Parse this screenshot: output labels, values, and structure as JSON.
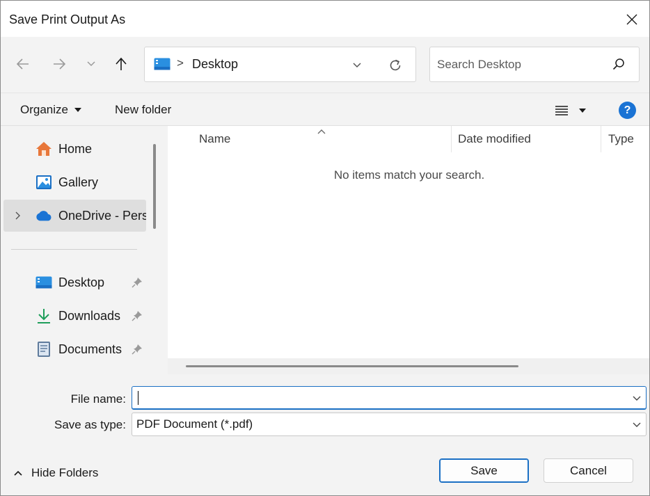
{
  "window": {
    "title": "Save Print Output As"
  },
  "address_bar": {
    "location_icon": "desktop-folder-icon",
    "separator": ">",
    "current_location": "Desktop"
  },
  "search": {
    "placeholder": "Search Desktop",
    "value": ""
  },
  "command_bar": {
    "organize_label": "Organize",
    "new_folder_label": "New folder"
  },
  "sidebar": {
    "items": [
      {
        "label": "Home",
        "icon": "home-icon",
        "selected": false
      },
      {
        "label": "Gallery",
        "icon": "gallery-icon",
        "selected": false
      },
      {
        "label": "OneDrive - Perso",
        "icon": "onedrive-cloud-icon",
        "selected": true,
        "expandable": true
      },
      {
        "label": "Desktop",
        "icon": "desktop-folder-icon",
        "pinned": true
      },
      {
        "label": "Downloads",
        "icon": "download-arrow-icon",
        "pinned": true
      },
      {
        "label": "Documents",
        "icon": "document-icon",
        "pinned": true
      }
    ]
  },
  "file_list": {
    "columns": [
      "Name",
      "Date modified",
      "Type"
    ],
    "empty_message": "No items match your search."
  },
  "fields": {
    "file_name_label": "File name:",
    "file_name_value": "",
    "save_as_type_label": "Save as type:",
    "save_as_type_value": "PDF Document (*.pdf)"
  },
  "footer": {
    "hide_folders_label": "Hide Folders",
    "save_label": "Save",
    "cancel_label": "Cancel"
  },
  "colors": {
    "accent": "#1a6fc4",
    "help_badge": "#1a73d4",
    "folder_blue": "#2a8fe0",
    "home_orange": "#e8773a",
    "downloads_green": "#1e9e5a"
  }
}
